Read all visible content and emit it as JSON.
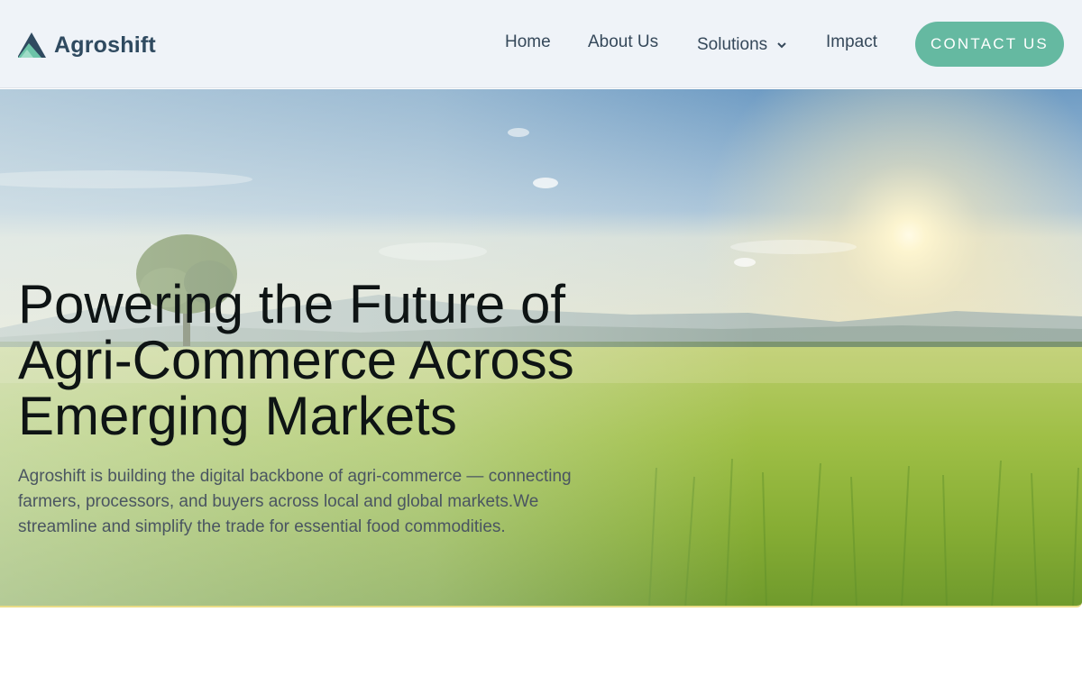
{
  "brand": {
    "name": "Agroshift"
  },
  "nav": {
    "home": "Home",
    "about": "About Us",
    "solutions": "Solutions",
    "impact": "Impact",
    "contact": "CONTACT US"
  },
  "hero": {
    "headline": "Powering the Future of Agri-Commerce Across Emerging Markets",
    "description": "Agroshift is building the digital backbone of agri-commerce — connecting farmers, processors, and buyers across local and global markets.We streamline and simplify the trade for essential food commodities."
  },
  "icons": {
    "logo": "agroshift-mountain-logo",
    "solutions_chevron": "chevron-down"
  },
  "colors": {
    "header_bg": "#eff3f8",
    "accent": "#65b9a1",
    "brand_text": "#2f4a60",
    "nav_text": "#35485a",
    "headline": "#0e1414"
  }
}
